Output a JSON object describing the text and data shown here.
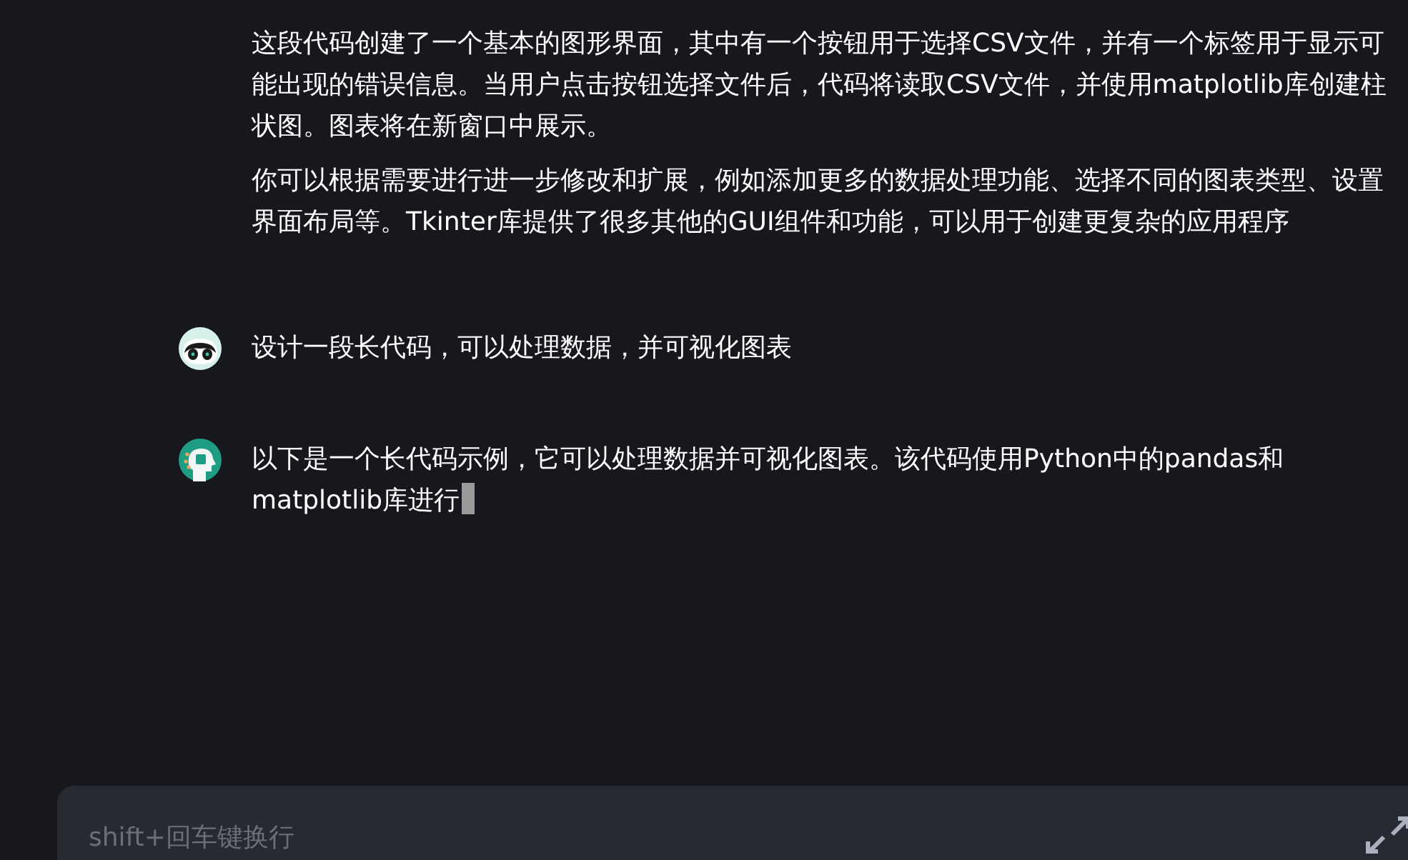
{
  "messages": [
    {
      "kind": "assistant",
      "show_avatar": false,
      "paragraphs": [
        "这段代码创建了一个基本的图形界面，其中有一个按钮用于选择CSV文件，并有一个标签用于显示可能出现的错误信息。当用户点击按钮选择文件后，代码将读取CSV文件，并使用matplotlib库创建柱状图。图表将在新窗口中展示。",
        "你可以根据需要进行进一步修改和扩展，例如添加更多的数据处理功能、选择不同的图表类型、设置界面布局等。Tkinter库提供了很多其他的GUI组件和功能，可以用于创建更复杂的应用程序"
      ],
      "cursor": false
    },
    {
      "kind": "user",
      "show_avatar": true,
      "paragraphs": [
        "设计一段长代码，可以处理数据，并可视化图表"
      ],
      "cursor": false
    },
    {
      "kind": "assistant",
      "show_avatar": true,
      "paragraphs": [
        "以下是一个长代码示例，它可以处理数据并可视化图表。该代码使用Python中的pandas和matplotlib库进行"
      ],
      "cursor": true
    }
  ],
  "input": {
    "placeholder": "shift+回车键换行"
  }
}
